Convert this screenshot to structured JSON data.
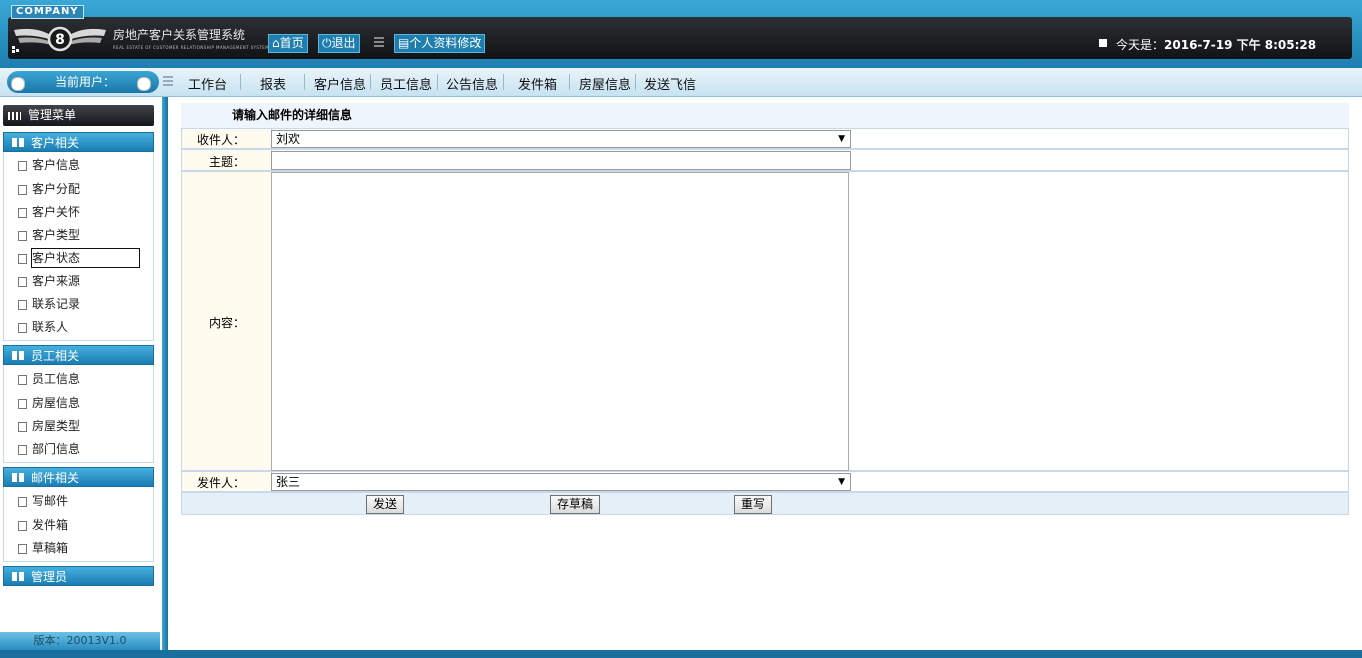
{
  "header": {
    "company": "COMPANY",
    "system_title": "房地产客户关系管理系统",
    "system_subtitle": "REAL ESTATE OF CUSTOMER RELATIONSHIP MANAGEMENT SYSTEM",
    "home_label": "首页",
    "exit_label": "退出",
    "profile_label": "个人资料修改",
    "date_prefix": "今天是：",
    "date_value": "2016-7-19 下午 8:05:28"
  },
  "navbar": {
    "current_user_label": "当前用户：",
    "items": [
      "工作台",
      "报表",
      "客户信息",
      "员工信息",
      "公告信息",
      "发件箱",
      "房屋信息",
      "发送飞信"
    ]
  },
  "sidebar": {
    "title": "管理菜单",
    "groups": [
      {
        "label": "客户相关",
        "items": [
          "客户信息",
          "客户分配",
          "客户关怀",
          "客户类型",
          "客户状态",
          "客户来源",
          "联系记录",
          "联系人"
        ]
      },
      {
        "label": "员工相关",
        "items": [
          "员工信息",
          "房屋信息",
          "房屋类型",
          "部门信息"
        ]
      },
      {
        "label": "邮件相关",
        "items": [
          "写邮件",
          "发件箱",
          "草稿箱"
        ]
      },
      {
        "label": "管理员",
        "items": []
      }
    ],
    "active_item": "客户状态",
    "version": "版本：20013V1.0"
  },
  "form": {
    "title": "请输入邮件的详细信息",
    "recipient_label": "收件人：",
    "recipient_value": "刘欢",
    "subject_label": "主题：",
    "subject_value": "",
    "content_label": "内容：",
    "content_value": "",
    "sender_label": "发件人：",
    "sender_value": "张三",
    "send_label": "发送",
    "draft_label": "存草稿",
    "reset_label": "重写"
  }
}
